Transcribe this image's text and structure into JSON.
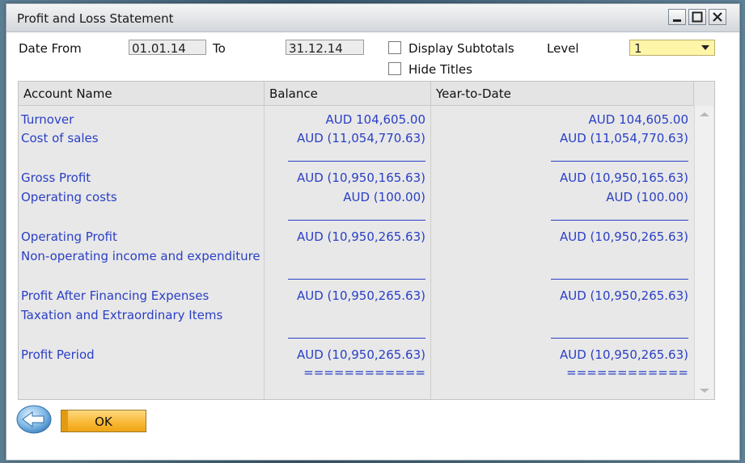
{
  "window": {
    "title": "Profit and Loss Statement"
  },
  "filters": {
    "date_from_label": "Date From",
    "date_from_value": "01.01.14",
    "to_label": "To",
    "to_value": "31.12.14",
    "display_subtotals_label": "Display Subtotals",
    "hide_titles_label": "Hide Titles",
    "level_label": "Level",
    "level_value": "1"
  },
  "table": {
    "columns": [
      "Account Name",
      "Balance",
      "Year-to-Date"
    ],
    "rows": [
      {
        "name": "Turnover",
        "balance": "AUD  104,605.00",
        "ytd": "AUD  104,605.00"
      },
      {
        "name": "Cost of sales",
        "balance": "AUD (11,054,770.63)",
        "ytd": "AUD (11,054,770.63)"
      },
      {
        "name": "Gross Profit",
        "balance": "AUD (10,950,165.63)",
        "ytd": "AUD (10,950,165.63)"
      },
      {
        "name": "Operating costs",
        "balance": "AUD (100.00)",
        "ytd": "AUD (100.00)"
      },
      {
        "name": "Operating Profit",
        "balance": "AUD (10,950,265.63)",
        "ytd": "AUD (10,950,265.63)"
      },
      {
        "name": "Non-operating income and expenditure",
        "balance": "",
        "ytd": ""
      },
      {
        "name": "Profit After Financing Expenses",
        "balance": "AUD (10,950,265.63)",
        "ytd": "AUD (10,950,265.63)"
      },
      {
        "name": "Taxation and Extraordinary Items",
        "balance": "",
        "ytd": ""
      },
      {
        "name": "Profit Period",
        "balance": "AUD (10,950,265.63)",
        "ytd": "AUD (10,950,265.63)"
      }
    ],
    "total_marker": "============"
  },
  "footer": {
    "ok_label": "OK"
  },
  "icons": {
    "back": "back-arrow-icon",
    "minimize": "minimize-icon",
    "maximize": "maximize-icon",
    "close": "close-icon"
  },
  "colors": {
    "text_blue": "#2a3fc6",
    "ok_button": "#f7b733",
    "level_select": "#fff5a8"
  }
}
